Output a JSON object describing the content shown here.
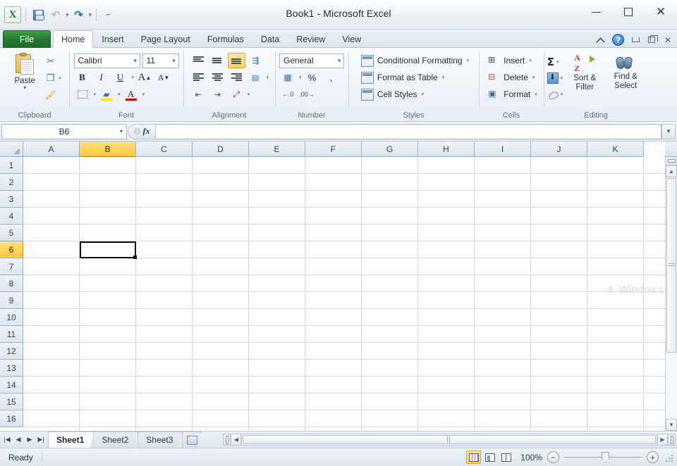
{
  "window": {
    "title": "Book1  -  Microsoft Excel",
    "app_icon": "excel-icon",
    "minimize": "minimize-icon",
    "maximize": "maximize-icon",
    "close": "close-icon"
  },
  "quick_access": {
    "save": "Save",
    "undo": "Undo",
    "undo_arrow": "▾",
    "redo": "Redo",
    "redo_arrow": "▾",
    "customize": "Customize Quick Access Toolbar"
  },
  "ribbon": {
    "file_tab": "File",
    "tabs": [
      {
        "label": "Home",
        "active": true
      },
      {
        "label": "Insert",
        "active": false
      },
      {
        "label": "Page Layout",
        "active": false
      },
      {
        "label": "Formulas",
        "active": false
      },
      {
        "label": "Data",
        "active": false
      },
      {
        "label": "Review",
        "active": false
      },
      {
        "label": "View",
        "active": false
      }
    ],
    "collapse": "Minimize the Ribbon",
    "help": "?",
    "groups": {
      "clipboard": {
        "label": "Clipboard",
        "paste": "Paste",
        "paste_arrow": "▾",
        "cut": "Cut",
        "copy": "Copy",
        "copy_arrow": "▾",
        "format_painter": "Format Painter"
      },
      "font": {
        "label": "Font",
        "font_name": "Calibri",
        "font_size": "11",
        "bold": "B",
        "italic": "I",
        "underline": "U",
        "underline_arrow": "▾",
        "grow_font": "A",
        "shrink_font": "A",
        "borders": "Borders",
        "borders_arrow": "▾",
        "fill_color": "Fill Color",
        "fill_arrow": "▾",
        "font_color": "A",
        "font_color_arrow": "▾",
        "fill_swatch": "#ffe400",
        "font_color_swatch": "#c00000"
      },
      "alignment": {
        "label": "Alignment",
        "align_top": "Top Align",
        "align_middle": "Middle Align",
        "align_bottom": "Bottom Align",
        "wrap_text": "Wrap Text",
        "align_left": "Align Text Left",
        "align_center": "Center",
        "align_right": "Align Text Right",
        "merge_center": "Merge & Center",
        "merge_arrow": "▾",
        "decrease_indent": "Decrease Indent",
        "increase_indent": "Increase Indent",
        "orientation": "Orientation",
        "orientation_arrow": "▾"
      },
      "number": {
        "label": "Number",
        "format": "General",
        "format_arrow": "▾",
        "accounting": "Accounting Number Format",
        "accounting_arrow": "▾",
        "percent": "%",
        "comma": ",",
        "increase_decimal": "Increase Decimal",
        "decrease_decimal": "Decrease Decimal"
      },
      "styles": {
        "label": "Styles",
        "items": [
          {
            "label": "Conditional Formatting",
            "arrow": "▾"
          },
          {
            "label": "Format as Table",
            "arrow": "▾"
          },
          {
            "label": "Cell Styles",
            "arrow": "▾"
          }
        ]
      },
      "cells": {
        "label": "Cells",
        "items": [
          {
            "label": "Insert",
            "arrow": "▾"
          },
          {
            "label": "Delete",
            "arrow": "▾"
          },
          {
            "label": "Format",
            "arrow": "▾"
          }
        ]
      },
      "editing": {
        "label": "Editing",
        "autosum": "Σ",
        "autosum_arrow": "▾",
        "fill": "Fill",
        "fill_arrow": "▾",
        "clear": "Clear",
        "clear_arrow": "▾",
        "sort_filter_l1": "Sort &",
        "sort_filter_l2": "Filter",
        "sort_filter_arrow": "▾",
        "find_select_l1": "Find &",
        "find_select_l2": "Select",
        "find_select_arrow": "▾"
      }
    }
  },
  "formula_bar": {
    "name_box": "B6",
    "name_box_arrow": "▾",
    "fx": "fx",
    "formula_value": "",
    "formula_placeholder": "",
    "expand_arrow": "▾"
  },
  "grid": {
    "columns": [
      "A",
      "B",
      "C",
      "D",
      "E",
      "F",
      "G",
      "H",
      "I",
      "J",
      "K"
    ],
    "rows": [
      "1",
      "2",
      "3",
      "4",
      "5",
      "6",
      "7",
      "8",
      "9",
      "10",
      "11",
      "12",
      "13",
      "14",
      "15",
      "16"
    ],
    "selected_cell": "B6",
    "selected_column": "B",
    "selected_row": "6",
    "watermark": "Windows",
    "select_all": "select-all-corner"
  },
  "sheets": {
    "first": "First Sheet",
    "prev": "Previous Sheet",
    "next": "Next Sheet",
    "last": "Last Sheet",
    "tabs": [
      {
        "label": "Sheet1",
        "active": true
      },
      {
        "label": "Sheet2",
        "active": false
      },
      {
        "label": "Sheet3",
        "active": false
      }
    ],
    "insert_sheet": "Insert Worksheet"
  },
  "status_bar": {
    "state": "Ready",
    "view_normal": "Normal",
    "view_page_layout": "Page Layout",
    "view_page_break": "Page Break Preview",
    "zoom": "100%",
    "zoom_out": "−",
    "zoom_in": "+"
  }
}
